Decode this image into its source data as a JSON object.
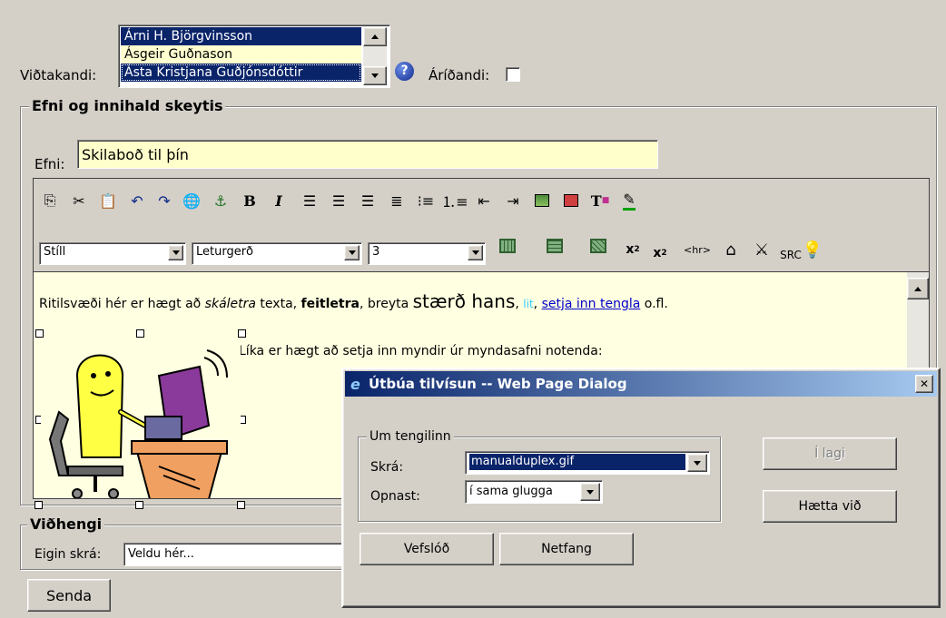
{
  "recipient": {
    "label": "Viðtakandi:",
    "options": [
      "Árni H. Björgvinsson",
      "Ásgeir Guðnason",
      "Ásta Kristjana Guðjónsdóttir"
    ],
    "selected": [
      0,
      2
    ],
    "help_icon": "question-circle-icon",
    "sender_label": "Áríðandi:"
  },
  "content_group": {
    "legend": "Efni og innihald skeytis",
    "subject_label": "Efni:",
    "subject_value": "Skilaboð til þín"
  },
  "toolbar": {
    "row1_icons": [
      "copy-icon",
      "cut-icon",
      "paste-icon",
      "undo-icon",
      "redo-icon",
      "insert-link-icon",
      "insert-anchor-icon",
      "bold-icon",
      "italic-icon",
      "align-left-icon",
      "align-center-icon",
      "align-right-icon",
      "align-justify-icon",
      "bullet-list-icon",
      "numbered-list-icon",
      "outdent-icon",
      "indent-icon",
      "insert-image-icon",
      "insert-table-icon",
      "text-color-icon",
      "highlight-icon"
    ],
    "style_select": "Stíll",
    "font_select": "Leturgerð",
    "size_select": "3",
    "row2_icons": [
      "insert-row-icon",
      "insert-column-icon",
      "delete-cells-icon",
      "superscript-icon",
      "subscript-icon",
      "horizontal-rule-icon",
      "insert-special-icon",
      "remove-format-icon",
      "source-icon",
      "tip-icon"
    ],
    "hr_label": "<hr>",
    "src_label": "SRC",
    "bold_glyph": "B",
    "italic_glyph": "I"
  },
  "editor": {
    "line1_a": "Ritilsvæði hér er hægt að ",
    "line1_italic": "skáletra",
    "line1_b": " texta, ",
    "line1_bold": "feitletra",
    "line1_c": ", breyta ",
    "line1_big": "stærð hans",
    "line1_d": ", ",
    "line1_color": "lit",
    "line1_e": ", ",
    "line1_link": "setja inn tengla",
    "line1_f": " o.fl.",
    "line2": "Líka er hægt að setja inn myndir úr myndasafni notenda:"
  },
  "attachments": {
    "legend": "Viðhengi",
    "file_label": "Eigin skrá:",
    "file_value": "Veldu hér..."
  },
  "send_button": "Senda",
  "dialog": {
    "title": "Útbúa tilvísun -- Web Page Dialog",
    "group_legend": "Um tengilinn",
    "file_label": "Skrá:",
    "file_value": "manualduplex.gif",
    "open_label": "Opnast:",
    "open_value": "í sama glugga",
    "ok_button": "Í lagi",
    "cancel_button": "Hætta við",
    "url_button": "Vefslóð",
    "email_button": "Netfang",
    "close_glyph": "✕"
  },
  "colors": {
    "selection": "#0a246a",
    "editor_bg": "#ffffe1",
    "subject_bg": "#ffffcc",
    "link": "#0000cc",
    "cyan_text": "#33ccff",
    "titlebar_start": "#0a246a",
    "titlebar_end": "#a6caf0"
  }
}
